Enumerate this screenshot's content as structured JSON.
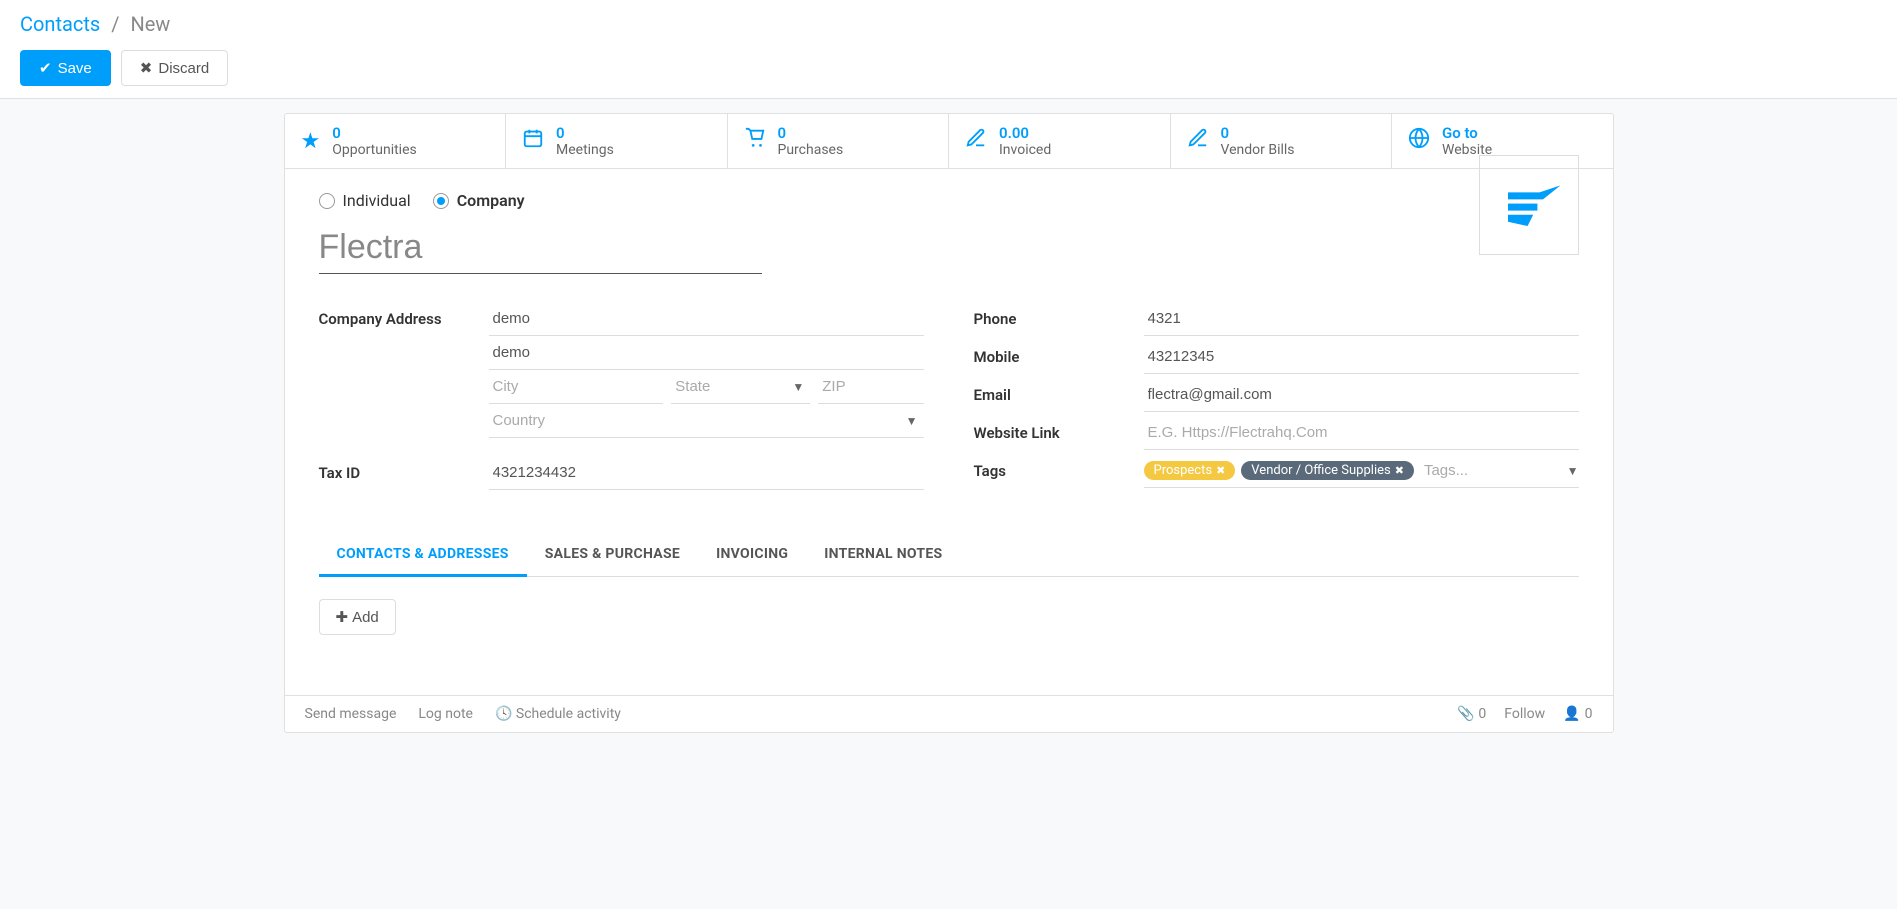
{
  "breadcrumb": {
    "root": "Contacts",
    "current": "New"
  },
  "buttons": {
    "save": "Save",
    "discard": "Discard"
  },
  "stats": [
    {
      "icon": "star",
      "value": "0",
      "label": "Opportunities"
    },
    {
      "icon": "calendar",
      "value": "0",
      "label": "Meetings"
    },
    {
      "icon": "cart",
      "value": "0",
      "label": "Purchases"
    },
    {
      "icon": "pencil-dollar",
      "value": "0.00",
      "label": "Invoiced"
    },
    {
      "icon": "pencil",
      "value": "0",
      "label": "Vendor Bills"
    },
    {
      "icon": "globe",
      "value": "Go to",
      "label": "Website"
    }
  ],
  "type_radio": {
    "individual": "Individual",
    "company": "Company",
    "selected": "company"
  },
  "name_value": "Flectra",
  "left_fields": {
    "address_label": "Company Address",
    "street1": "demo",
    "street2": "demo",
    "city_ph": "City",
    "state_ph": "State",
    "zip_ph": "ZIP",
    "country_ph": "Country",
    "taxid_label": "Tax ID",
    "taxid_value": "4321234432"
  },
  "right_fields": {
    "phone_label": "Phone",
    "phone_value": "4321",
    "mobile_label": "Mobile",
    "mobile_value": "43212345",
    "email_label": "Email",
    "email_value": "flectra@gmail.com",
    "website_label": "Website Link",
    "website_ph": "E.G. Https://Flectrahq.Com",
    "tags_label": "Tags",
    "tags": [
      {
        "name": "Prospects",
        "color": "tag-yellow"
      },
      {
        "name": "Vendor / Office Supplies",
        "color": "tag-dark"
      }
    ],
    "tags_ph": "Tags..."
  },
  "tabs": [
    "CONTACTS & ADDRESSES",
    "SALES & PURCHASE",
    "INVOICING",
    "INTERNAL NOTES"
  ],
  "add_label": "Add",
  "footer": {
    "send": "Send message",
    "log": "Log note",
    "schedule": "Schedule activity",
    "attach_count": "0",
    "follow_label": "Follow",
    "follower_count": "0"
  }
}
